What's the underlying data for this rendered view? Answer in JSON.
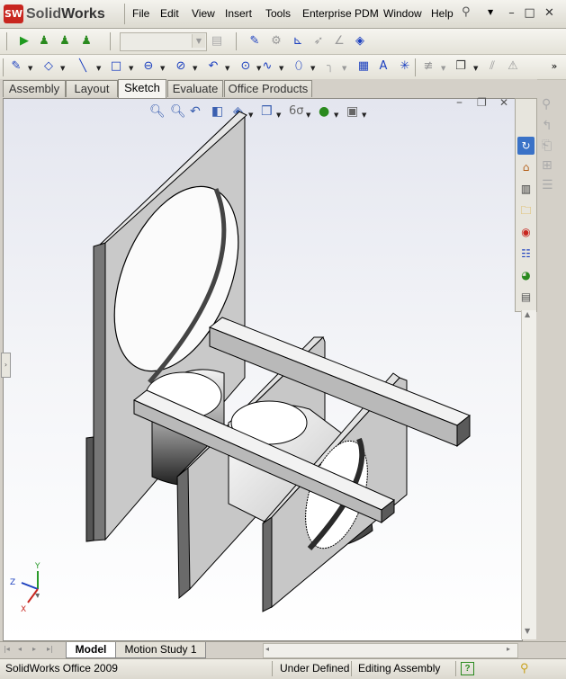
{
  "app": {
    "logo_mark": "SW",
    "logo_solid": "Solid",
    "logo_works": "Works"
  },
  "menu": [
    "File",
    "Edit",
    "View",
    "Insert",
    "Tools",
    "Enterprise PDM",
    "Window",
    "Help"
  ],
  "window_controls": {
    "min": "–",
    "max": "□",
    "close": "✕"
  },
  "tabs": [
    {
      "label": "Assembly",
      "active": false
    },
    {
      "label": "Layout",
      "active": false
    },
    {
      "label": "Sketch",
      "active": true
    },
    {
      "label": "Evaluate",
      "active": false
    },
    {
      "label": "Office Products",
      "active": false
    }
  ],
  "doc_controls": {
    "min": "–",
    "restore": "❐",
    "close": "✕"
  },
  "bottom_tabs": [
    {
      "label": "Model",
      "active": true
    },
    {
      "label": "Motion Study 1",
      "active": false
    }
  ],
  "status": {
    "product": "SolidWorks Office 2009",
    "state": "Under Defined",
    "mode": "Editing Assembly",
    "help": "?"
  },
  "triad": {
    "y": "Y",
    "z": "Z",
    "x": "X"
  },
  "colors": {
    "accent_green": "#2a8a1e",
    "brand_red": "#c8261f",
    "sketch_blue": "#1b3fbf"
  }
}
